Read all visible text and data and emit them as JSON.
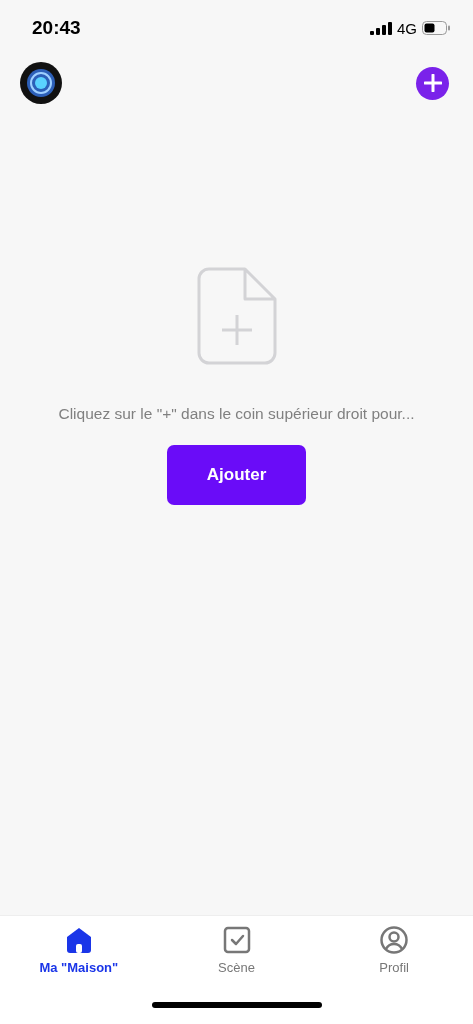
{
  "status_bar": {
    "time": "20:43",
    "network": "4G"
  },
  "empty_state": {
    "message": "Cliquez sur le \"+\" dans le coin supérieur droit pour...",
    "button": "Ajouter"
  },
  "tabs": [
    {
      "label": "Ma \"Maison\"",
      "kind": "home",
      "selected": true
    },
    {
      "label": "Scène",
      "kind": "scene",
      "selected": false
    },
    {
      "label": "Profil",
      "kind": "profile",
      "selected": false
    }
  ]
}
